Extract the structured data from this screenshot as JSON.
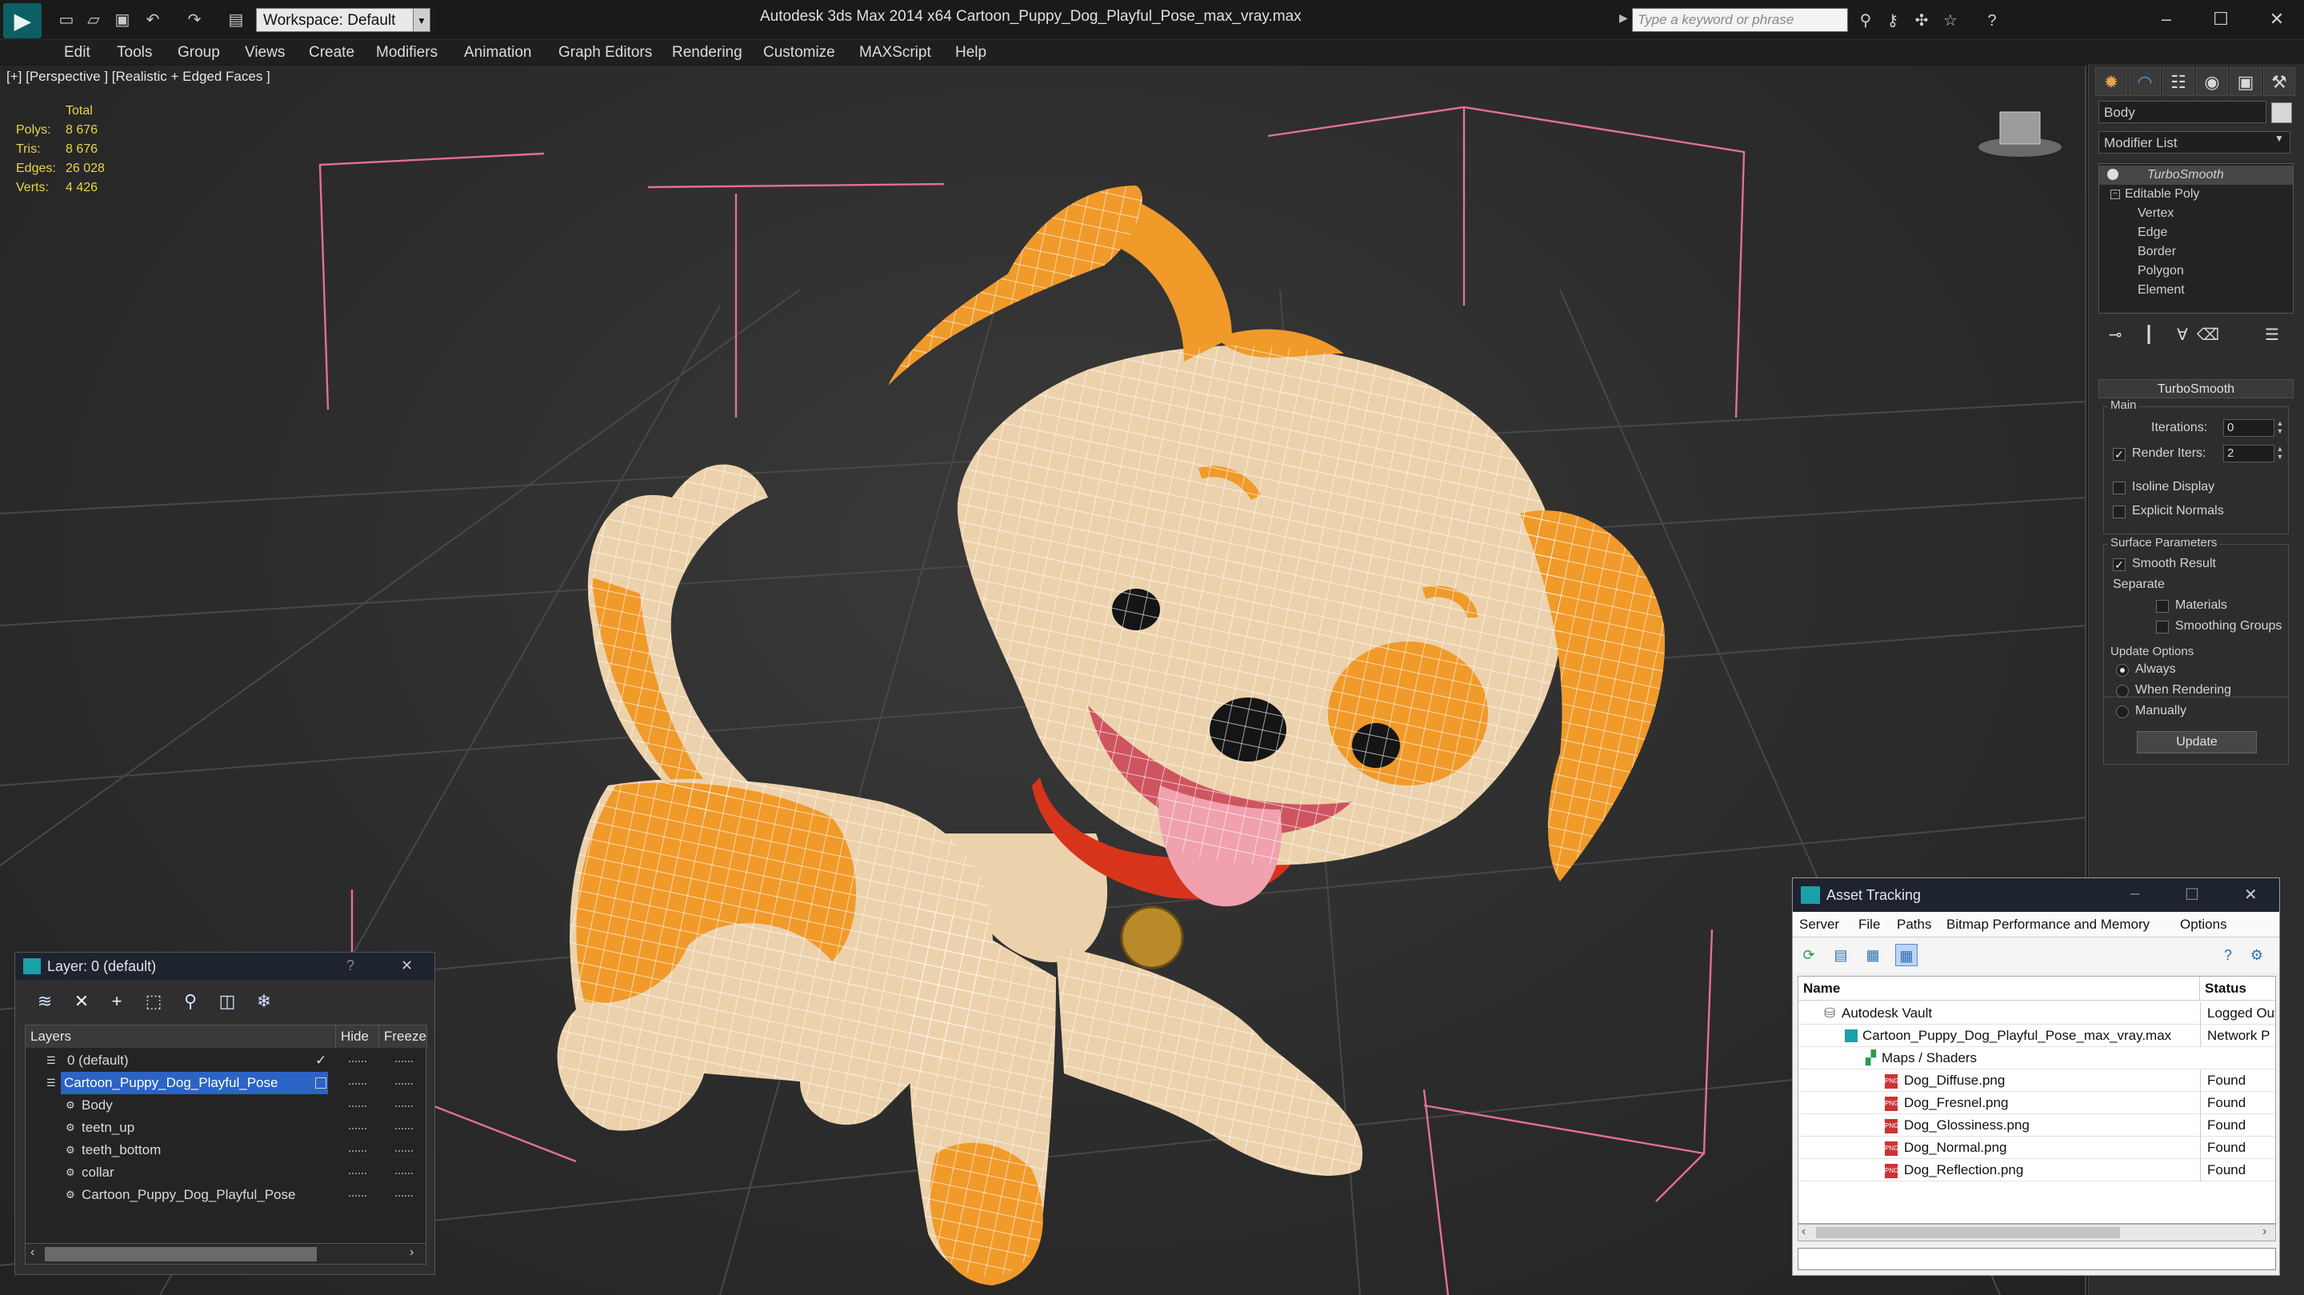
{
  "titlebar": {
    "app_title": "Autodesk 3ds Max  2014 x64      Cartoon_Puppy_Dog_Playful_Pose_max_vray.max",
    "workspace_label": "Workspace: Default",
    "search_placeholder": "Type a keyword or phrase",
    "logo_glyph": "▶"
  },
  "menu": [
    "Edit",
    "Tools",
    "Group",
    "Views",
    "Create",
    "Modifiers",
    "Animation",
    "Graph Editors",
    "Rendering",
    "Customize",
    "MAXScript",
    "Help"
  ],
  "viewport": {
    "label": "[+] [Perspective ] [Realistic + Edged Faces ]",
    "stats": {
      "total_label": "Total",
      "rows": [
        {
          "label": "Polys:",
          "value": "8 676"
        },
        {
          "label": "Tris:",
          "value": "8 676"
        },
        {
          "label": "Edges:",
          "value": "26 028"
        },
        {
          "label": "Verts:",
          "value": "4 426"
        }
      ]
    }
  },
  "command_panel": {
    "object_name": "Body",
    "modifier_list": "Modifier List",
    "stack": [
      "TurboSmooth",
      "Editable Poly",
      "Vertex",
      "Edge",
      "Border",
      "Polygon",
      "Element"
    ],
    "rollout_title": "TurboSmooth",
    "main_group": "Main",
    "iterations_label": "Iterations:",
    "iterations_value": "0",
    "render_iters_label": "Render Iters:",
    "render_iters_value": "2",
    "isoline_label": "Isoline Display",
    "explicit_normals_label": "Explicit Normals",
    "surface_group": "Surface Parameters",
    "smooth_result_label": "Smooth Result",
    "separate_label": "Separate",
    "materials_label": "Materials",
    "smoothing_groups_label": "Smoothing Groups",
    "update_group": "Update Options",
    "always_label": "Always",
    "when_rendering_label": "When Rendering",
    "manually_label": "Manually",
    "update_button": "Update"
  },
  "layer_window": {
    "title": "Layer: 0 (default)",
    "help": "?",
    "close": "✕",
    "col_layers": "Layers",
    "col_hide": "Hide",
    "col_freeze": "Freeze",
    "rows": [
      {
        "name": "0 (default)",
        "indent": 0
      },
      {
        "name": "Cartoon_Puppy_Dog_Playful_Pose",
        "indent": 0
      },
      {
        "name": "Body",
        "indent": 1
      },
      {
        "name": "teetn_up",
        "indent": 1
      },
      {
        "name": "teeth_bottom",
        "indent": 1
      },
      {
        "name": "collar",
        "indent": 1
      },
      {
        "name": "Cartoon_Puppy_Dog_Playful_Pose",
        "indent": 1
      }
    ]
  },
  "asset_window": {
    "title": "Asset Tracking",
    "menu": [
      "Server",
      "File",
      "Paths",
      "Bitmap Performance and Memory",
      "Options"
    ],
    "col_name": "Name",
    "col_status": "Status",
    "rows": [
      {
        "name": "Autodesk Vault",
        "status": "Logged Out",
        "indent": 1
      },
      {
        "name": "Cartoon_Puppy_Dog_Playful_Pose_max_vray.max",
        "status": "Network P",
        "indent": 2
      },
      {
        "name": "Maps / Shaders",
        "status": "",
        "indent": 3
      },
      {
        "name": "Dog_Diffuse.png",
        "status": "Found",
        "indent": 4
      },
      {
        "name": "Dog_Fresnel.png",
        "status": "Found",
        "indent": 4
      },
      {
        "name": "Dog_Glossiness.png",
        "status": "Found",
        "indent": 4
      },
      {
        "name": "Dog_Normal.png",
        "status": "Found",
        "indent": 4
      },
      {
        "name": "Dog_Reflection.png",
        "status": "Found",
        "indent": 4
      }
    ]
  },
  "colors": {
    "accent": "#2b63c6",
    "stats_yellow": "#e9d44a",
    "dog_orange": "#f09a2a",
    "dog_cream": "#ecd2ac",
    "collar_red": "#d8341c"
  }
}
